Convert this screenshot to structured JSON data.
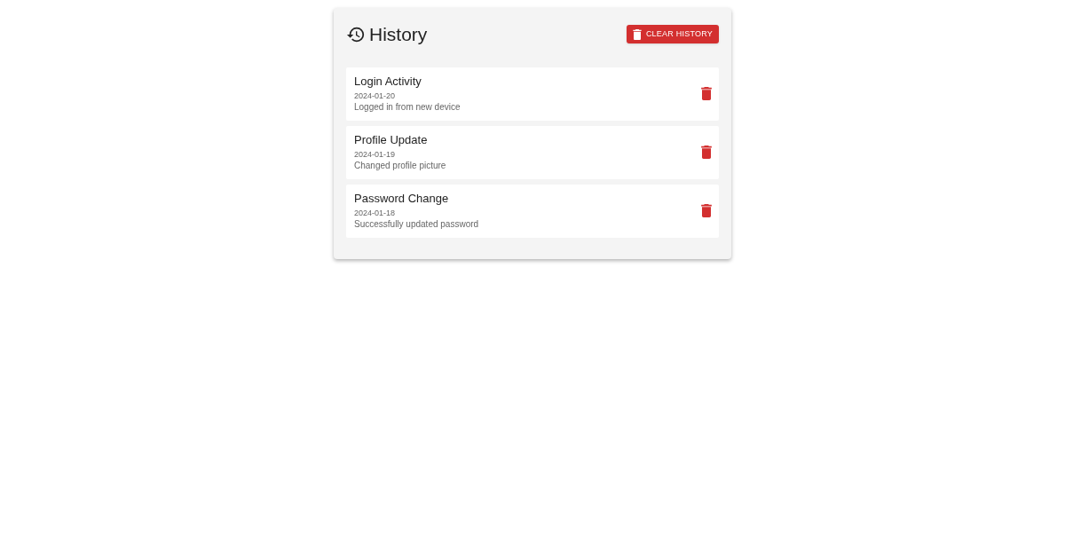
{
  "header": {
    "title": "History",
    "clear_button": "CLEAR HISTORY"
  },
  "entries": [
    {
      "title": "Login Activity",
      "date": "2024-01-20",
      "description": "Logged in from new device"
    },
    {
      "title": "Profile Update",
      "date": "2024-01-19",
      "description": "Changed profile picture"
    },
    {
      "title": "Password Change",
      "date": "2024-01-18",
      "description": "Successfully updated password"
    }
  ]
}
